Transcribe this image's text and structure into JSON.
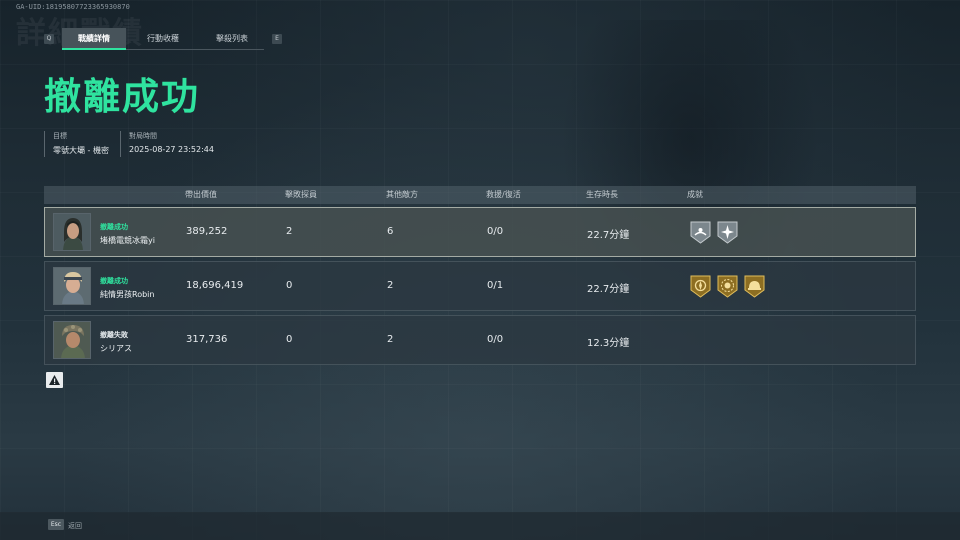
{
  "uid": "GA-UID:18195807723365930870",
  "background_title": "詳細戰績",
  "tabs": {
    "left_key": "Q",
    "right_key": "E",
    "items": [
      {
        "label": "戰績詳情",
        "active": true
      },
      {
        "label": "行動收穫",
        "active": false
      },
      {
        "label": "擊殺列表",
        "active": false
      }
    ]
  },
  "result_title": "撤離成功",
  "meta": {
    "target_label": "目標",
    "target_value": "零號大壩 - 機密",
    "time_label": "對局時間",
    "time_value": "2025-08-27 23:52:44"
  },
  "columns": [
    "帶出價值",
    "擊敗探員",
    "其他敵方",
    "救援/復活",
    "生存時長",
    "成就"
  ],
  "players": [
    {
      "status": "撤離成功",
      "status_type": "success",
      "name": "堵橋電競冰霜yi",
      "value": "389,252",
      "kills": "2",
      "other_enemies": "6",
      "rescue": "0/0",
      "survival": "22.7分鐘",
      "selected": true,
      "achievements": [
        "silver-wave-badge-icon",
        "silver-star-badge-icon"
      ]
    },
    {
      "status": "撤離成功",
      "status_type": "success",
      "name": "純情男孩Robin",
      "value": "18,696,419",
      "kills": "0",
      "other_enemies": "2",
      "rescue": "0/1",
      "survival": "22.7分鐘",
      "selected": false,
      "achievements": [
        "gold-compass-badge-icon",
        "gold-sun-badge-icon",
        "gold-helmet-badge-icon"
      ]
    },
    {
      "status": "撤離失敗",
      "status_type": "fail",
      "name": "シリアス",
      "value": "317,736",
      "kills": "0",
      "other_enemies": "2",
      "rescue": "0/0",
      "survival": "12.3分鐘",
      "selected": false,
      "achievements": []
    }
  ],
  "report_icon": "warning-triangle-icon",
  "footer": {
    "esc_key": "Esc",
    "esc_label": "返回"
  },
  "colors": {
    "accent": "#2fe39f",
    "medal_silver": "#8b969c",
    "medal_gold": "#b8912f"
  }
}
